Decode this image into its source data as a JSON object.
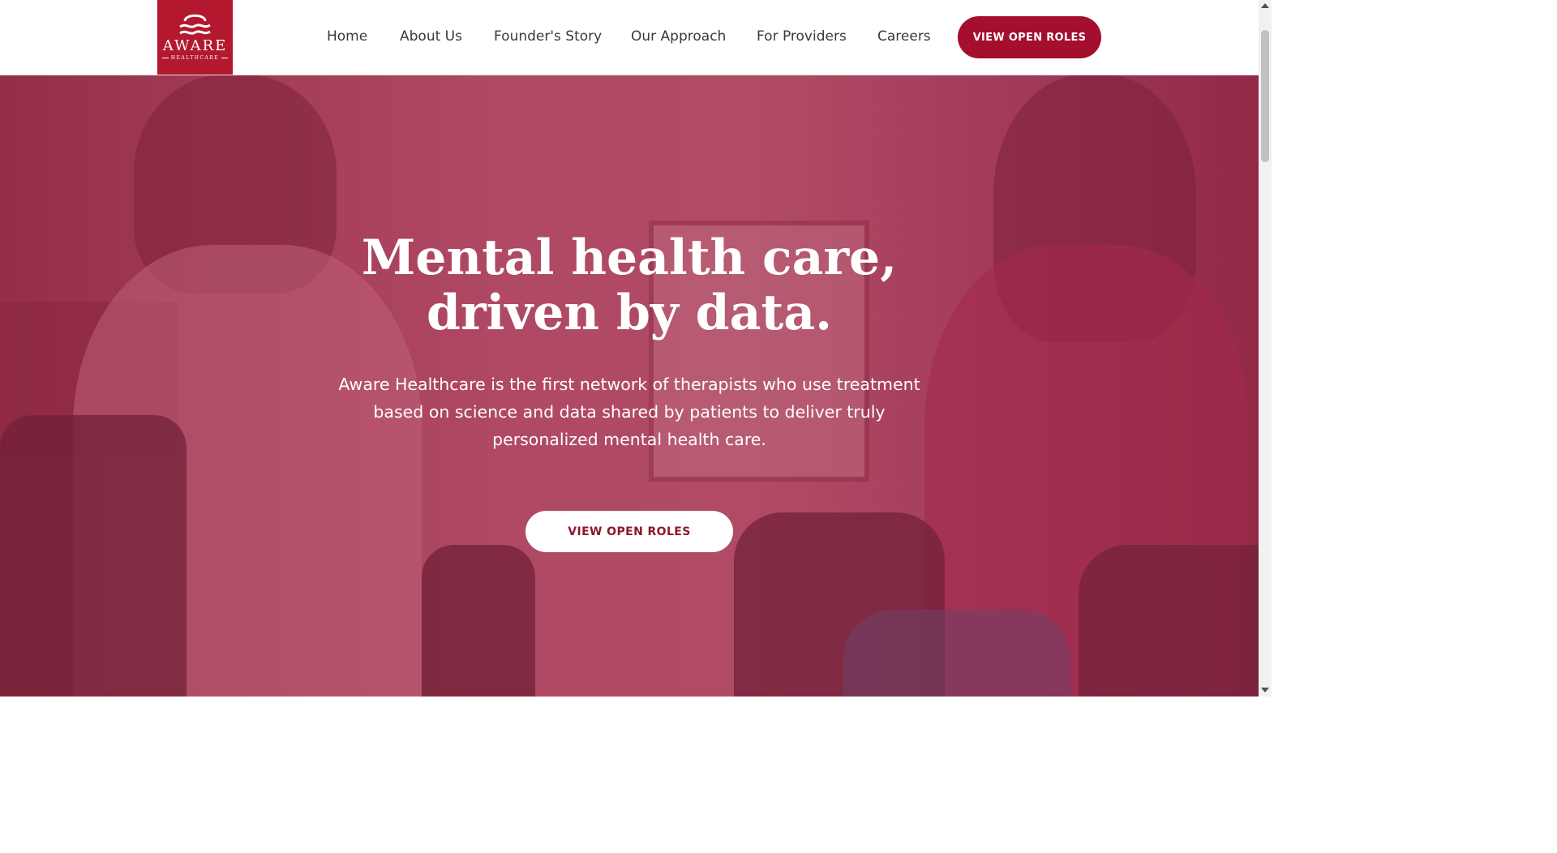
{
  "brand": {
    "name": "AWARE",
    "subtitle": "HEALTHCARE",
    "color": "#b3182f",
    "icon": "aware-wave-logo-icon"
  },
  "nav": {
    "items": [
      {
        "label": "Home"
      },
      {
        "label": "About Us"
      },
      {
        "label": "Founder's Story"
      },
      {
        "label": "Our Approach"
      },
      {
        "label": "For Providers"
      },
      {
        "label": "Careers"
      }
    ],
    "cta_label": "VIEW OPEN ROLES",
    "cta_color": "#a30f2d"
  },
  "hero": {
    "title_line1": "Mental health care,",
    "title_line2": "driven by data.",
    "description": "Aware Healthcare is the first network of therapists who use treatment based on science and data shared by patients to deliver truly personalized mental health care.",
    "cta_label": "VIEW OPEN ROLES",
    "overlay_color": "#b03a5c"
  }
}
